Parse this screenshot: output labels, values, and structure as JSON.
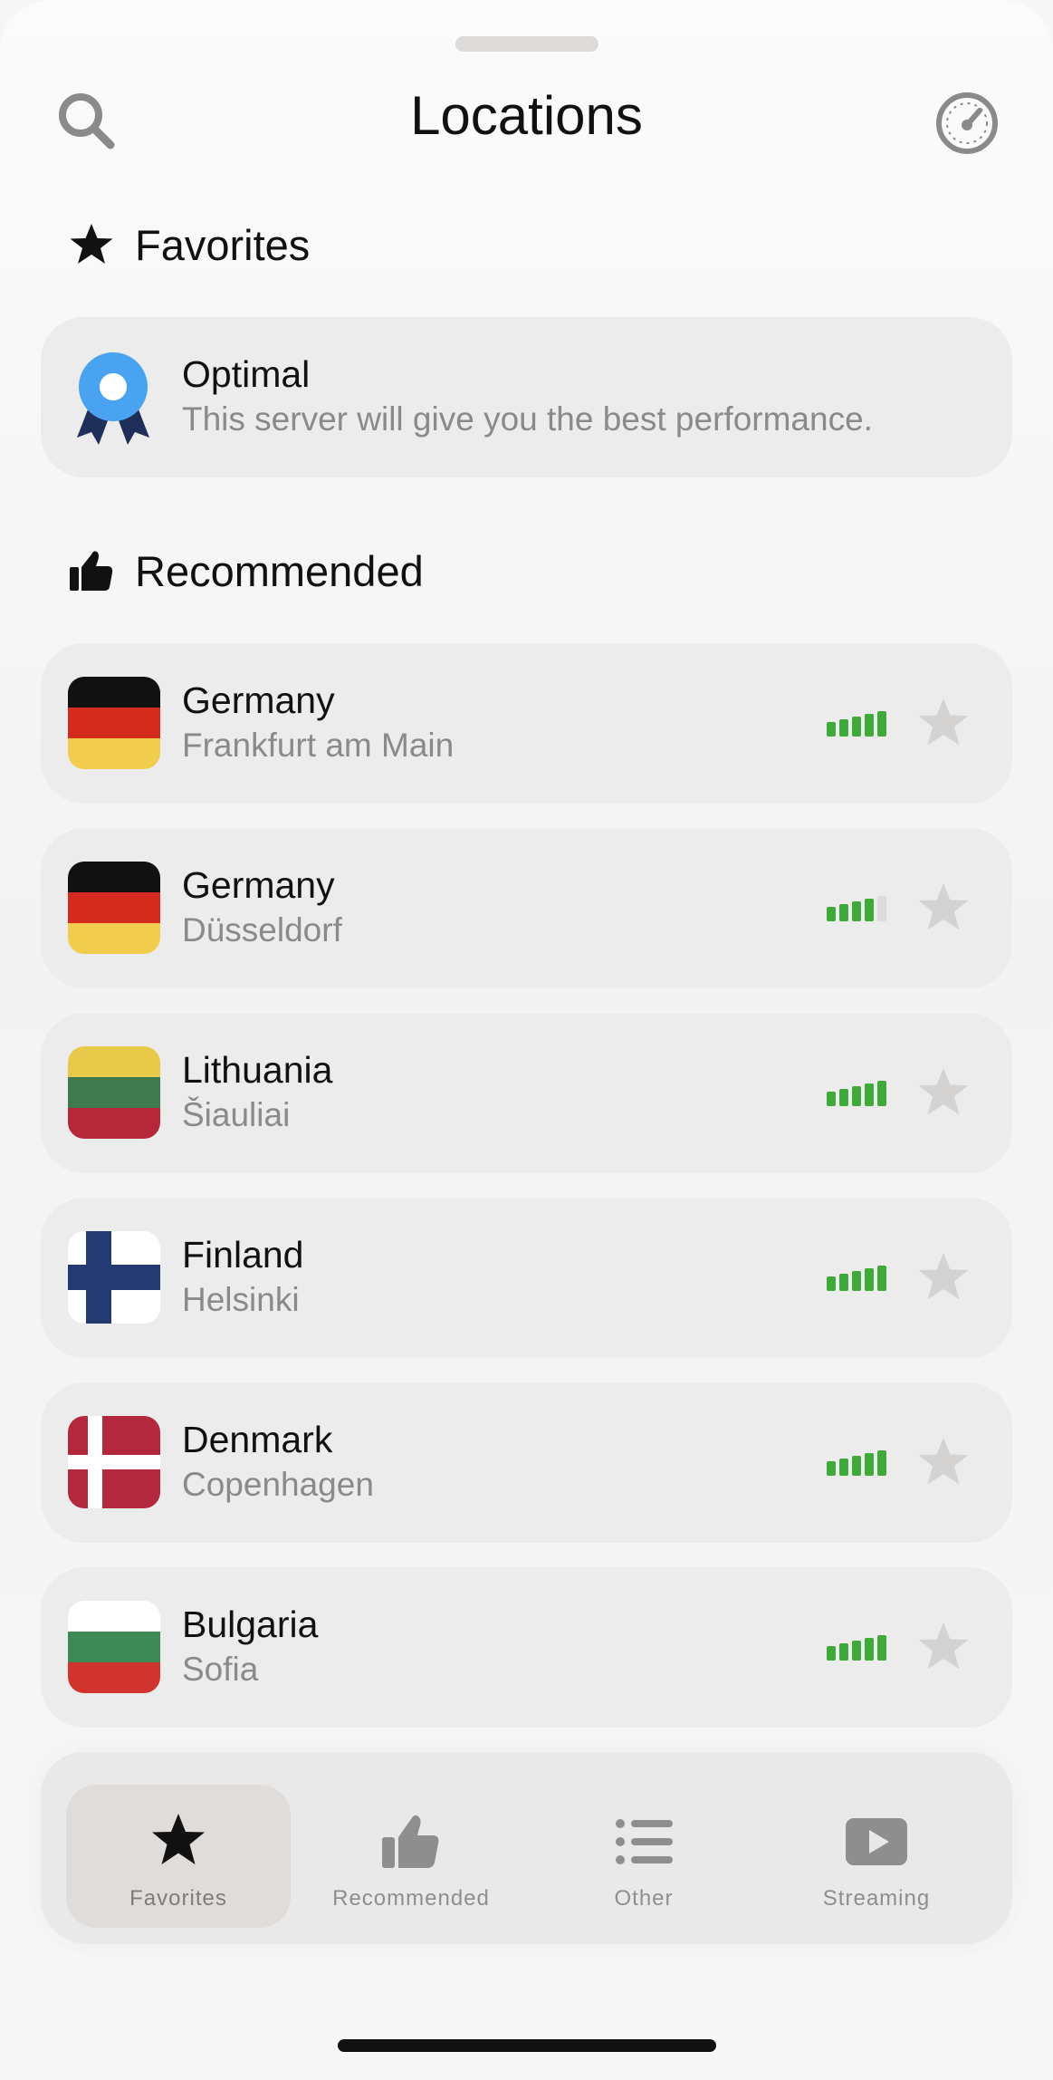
{
  "header": {
    "title": "Locations",
    "search_icon": "search-icon",
    "speed_icon": "speedometer-icon"
  },
  "sections": {
    "favorites": {
      "label": "Favorites",
      "icon": "star-icon"
    },
    "recommended": {
      "label": "Recommended",
      "icon": "thumbs-up-icon"
    }
  },
  "optimal": {
    "title": "Optimal",
    "subtitle": "This server will give you the best performance.",
    "icon": "award-ribbon-icon"
  },
  "servers": [
    {
      "country": "Germany",
      "city": "Frankfurt am Main",
      "flag": "de",
      "signal_bars": 5
    },
    {
      "country": "Germany",
      "city": "Düsseldorf",
      "flag": "de",
      "signal_bars": 4
    },
    {
      "country": "Lithuania",
      "city": "Šiauliai",
      "flag": "lt",
      "signal_bars": 5
    },
    {
      "country": "Finland",
      "city": "Helsinki",
      "flag": "fi",
      "signal_bars": 5
    },
    {
      "country": "Denmark",
      "city": "Copenhagen",
      "flag": "dk",
      "signal_bars": 5
    },
    {
      "country": "Bulgaria",
      "city": "Sofia",
      "flag": "bg",
      "signal_bars": 5
    }
  ],
  "tabs": [
    {
      "label": "Favorites",
      "icon": "star-icon",
      "active": true
    },
    {
      "label": "Recommended",
      "icon": "thumbs-up-icon",
      "active": false
    },
    {
      "label": "Other",
      "icon": "list-icon",
      "active": false
    },
    {
      "label": "Streaming",
      "icon": "play-icon",
      "active": false
    }
  ],
  "colors": {
    "signal_on": "#3faa3a",
    "signal_off": "#dcdcdc",
    "favorite_star_off": "#d5d3d1",
    "optimal_blue": "#4aa3f0",
    "optimal_navy": "#1f2f5a"
  }
}
